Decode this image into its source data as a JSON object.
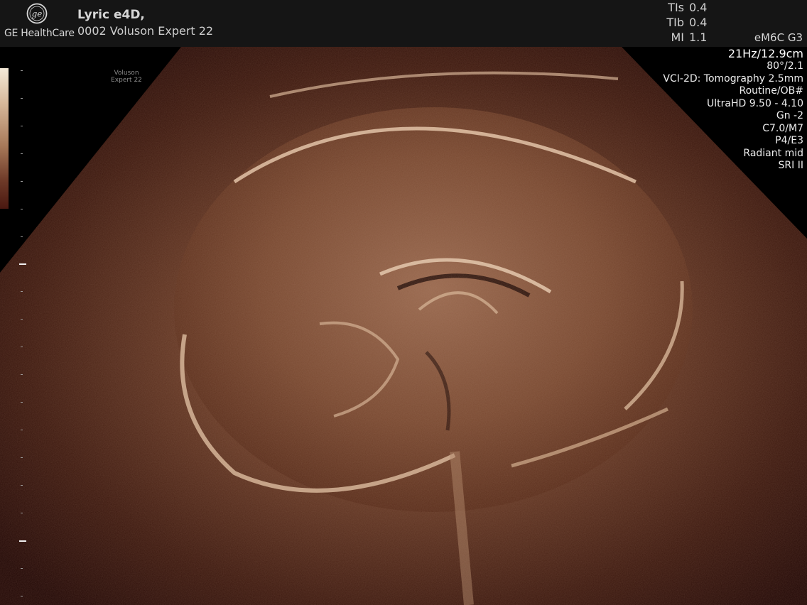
{
  "header": {
    "brand": "GE HealthCare",
    "patient_name": "Lyric e4D,",
    "system": "0002 Voluson Expert 22"
  },
  "safety": [
    {
      "label": "TIs",
      "value": "0.4"
    },
    {
      "label": "TIb",
      "value": "0.4"
    },
    {
      "label": "MI",
      "value": "1.1"
    }
  ],
  "probe": "eM6C G3",
  "params": {
    "frequency_depth": "21Hz/12.9cm",
    "angle": "80°/2.1",
    "vci": "VCI-2D: Tomography 2.5mm",
    "preset": "Routine/OB#",
    "ultrahd": "UltraHD 9.50 - 4.10",
    "gain": "Gn  -2",
    "cm": "C7.0/M7",
    "pe": "P4/E3",
    "radiant": "Radiant mid",
    "sri": "SRI II"
  },
  "watermark": {
    "line1": "Voluson",
    "line2": "Expert 22"
  },
  "colors": {
    "header_bg": "#151515",
    "image_tint": "#7a4a30",
    "text": "#e8e8e8"
  },
  "icons": {
    "logo": "ge-monogram-icon"
  }
}
